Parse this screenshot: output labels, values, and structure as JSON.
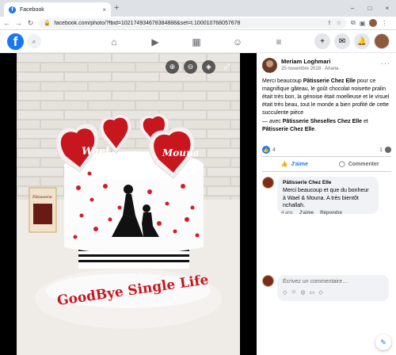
{
  "browser": {
    "tab_title": "Facebook",
    "tab_favicon": "f",
    "url": "facebook.com/photo/?fbid=102174934678384888&set=t.100010768057678"
  },
  "icons": {
    "close": "×",
    "new_tab": "+",
    "minimize": "–",
    "maximize": "□",
    "back": "←",
    "forward": "→",
    "reload": "↻",
    "lock": "🔒",
    "share": "⇪",
    "star": "☆",
    "extension": "⧉",
    "profile": "▣",
    "menu": "⋮",
    "search": "⌕",
    "home": "⌂",
    "watch": "▶",
    "marketplace": "▦",
    "groups": "☺",
    "hamburger": "≡",
    "plus": "+",
    "messenger": "✉",
    "bell": "🔔",
    "zoom_in": "⊕",
    "zoom_out": "⊖",
    "tag": "◈",
    "fullscreen": "⤢",
    "like": "👍",
    "comment": "◯",
    "emoji": "☺",
    "camera": "◎",
    "gif": "▭",
    "sticker": "◇",
    "edit": "✎"
  },
  "post": {
    "author": "Meriam Loghmari",
    "meta": "25 novembre 2018 · Ariana · ",
    "more": "···",
    "text_part1": "Merci beaucoup ",
    "text_bold1": "Pâtisserie Chez Elle",
    "text_part2": " pour ce magnifique gâteau, le goût chocolat noisette pralin était très bon, la génoise était moelleuse et le visuel était très beau, tout le monde a bien profité de cette succulente pièce",
    "tag_prefix": "— avec ",
    "tag_name1": "Pâtisserie Sheselles Chez Elle",
    "tag_mid": " et ",
    "tag_name2": "Pâtisserie Chez Elle",
    "tag_end": ".",
    "reaction_count": "4",
    "comment_count": "1",
    "like_label": "J'aime",
    "comment_label": "Commenter"
  },
  "comment": {
    "name": "Pâtisserie Chez Elle",
    "text": "Merci beaucoup et que du bonheur à Wael & Mouna. A très bientôt nchallah.",
    "age": "4 ans",
    "like": "J'aime",
    "reply": "Répondre"
  },
  "composer": {
    "placeholder": "Écrivez un commentaire…"
  },
  "photo_text": {
    "heart1": "Wael",
    "heart2": "Mouna",
    "board": "GoodBye Single Life",
    "box_label": "Pâtisserie"
  }
}
